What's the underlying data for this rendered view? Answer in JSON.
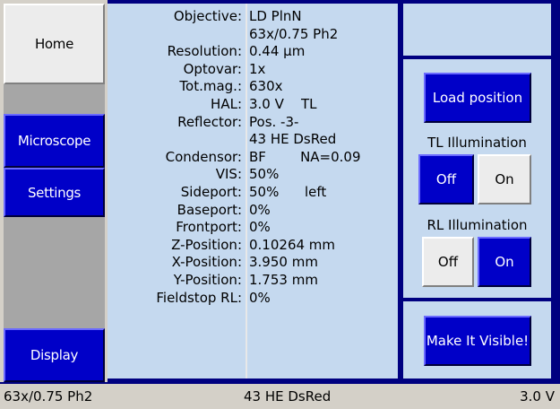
{
  "nav": {
    "home": "Home",
    "microscope": "Microscope",
    "settings": "Settings",
    "display": "Display"
  },
  "info": [
    {
      "label": "Objective:",
      "value": "LD PlnN"
    },
    {
      "label": "",
      "value": "63x/0.75 Ph2"
    },
    {
      "label": "Resolution:",
      "value": "0.44 µm"
    },
    {
      "label": "Optovar:",
      "value": "1x"
    },
    {
      "label": "Tot.mag.:",
      "value": "630x"
    },
    {
      "label": "HAL:",
      "value": "3.0 V    TL"
    },
    {
      "label": "Reflector:",
      "value": "Pos. -3-"
    },
    {
      "label": "",
      "value": "43 HE DsRed"
    },
    {
      "label": "Condensor:",
      "value": "BF        NA=0.09"
    },
    {
      "label": "VIS:",
      "value": "50%"
    },
    {
      "label": "Sideport:",
      "value": "50%      left"
    },
    {
      "label": "Baseport:",
      "value": "0%"
    },
    {
      "label": "Frontport:",
      "value": "0%"
    },
    {
      "label": "Z-Position:",
      "value": "0.10264 mm"
    },
    {
      "label": "X-Position:",
      "value": "3.950 mm"
    },
    {
      "label": "Y-Position:",
      "value": "1.753 mm"
    },
    {
      "label": "Fieldstop RL:",
      "value": "0%"
    }
  ],
  "right": {
    "load_position": "Load position",
    "tl_heading": "TL Illumination",
    "tl_off": "Off",
    "tl_on": "On",
    "rl_heading": "RL Illumination",
    "rl_off": "Off",
    "rl_on": "On",
    "make_visible": "Make It Visible!"
  },
  "status": {
    "objective": "63x/0.75 Ph2",
    "reflector": "43 HE DsRed",
    "voltage": "3.0 V"
  },
  "colors": {
    "frame": "#000080",
    "active_button": "#0000c8",
    "panel": "#c5d9ef",
    "status_bar": "#d4d0c8"
  }
}
